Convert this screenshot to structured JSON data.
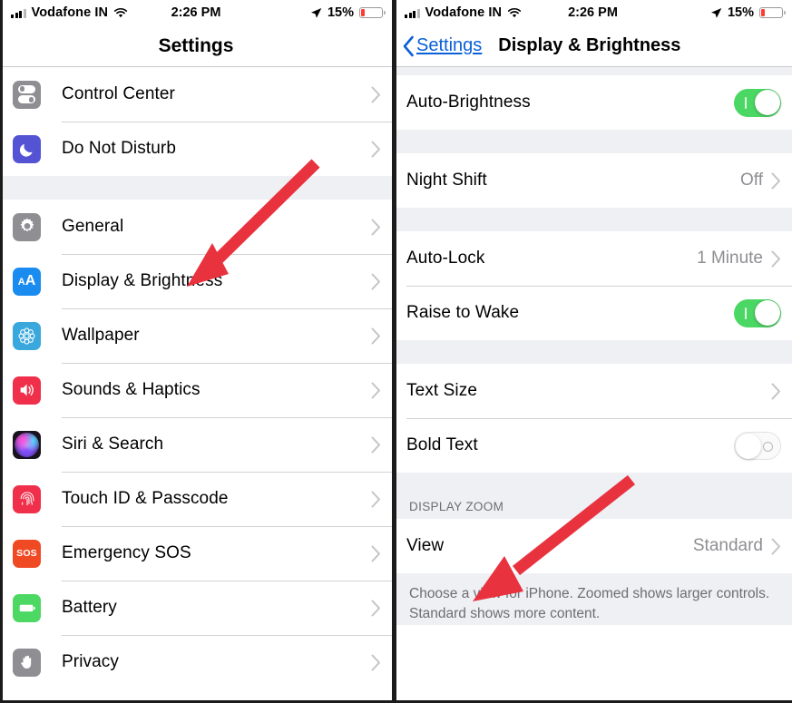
{
  "status_bar": {
    "carrier": "Vodafone IN",
    "time": "2:26 PM",
    "battery_percent": "15%",
    "signal_icon": "cellular-signal-icon",
    "wifi_icon": "wifi-icon",
    "location_icon": "location-arrow-icon",
    "battery_icon": "battery-icon"
  },
  "left_screen": {
    "nav": {
      "title": "Settings"
    },
    "groups": [
      {
        "items": [
          {
            "label": "Control Center",
            "icon": "control-center-icon"
          },
          {
            "label": "Do Not Disturb",
            "icon": "moon-icon"
          }
        ]
      },
      {
        "items": [
          {
            "label": "General",
            "icon": "gear-icon"
          },
          {
            "label": "Display & Brightness",
            "icon": "display-brightness-icon"
          },
          {
            "label": "Wallpaper",
            "icon": "wallpaper-flower-icon"
          },
          {
            "label": "Sounds & Haptics",
            "icon": "speaker-icon"
          },
          {
            "label": "Siri & Search",
            "icon": "siri-orb-icon"
          },
          {
            "label": "Touch ID & Passcode",
            "icon": "fingerprint-icon"
          },
          {
            "label": "Emergency SOS",
            "icon": "sos-icon"
          },
          {
            "label": "Battery",
            "icon": "battery-settings-icon"
          },
          {
            "label": "Privacy",
            "icon": "hand-icon"
          }
        ]
      }
    ]
  },
  "right_screen": {
    "nav": {
      "back_label": "Settings",
      "title": "Display & Brightness"
    },
    "rows": {
      "auto_brightness": {
        "label": "Auto-Brightness",
        "toggle": "on"
      },
      "night_shift": {
        "label": "Night Shift",
        "value": "Off"
      },
      "auto_lock": {
        "label": "Auto-Lock",
        "value": "1 Minute"
      },
      "raise_to_wake": {
        "label": "Raise to Wake",
        "toggle": "on"
      },
      "text_size": {
        "label": "Text Size",
        "value": ""
      },
      "bold_text": {
        "label": "Bold Text",
        "toggle": "off"
      },
      "view": {
        "label": "View",
        "value": "Standard"
      }
    },
    "display_zoom": {
      "header": "DISPLAY ZOOM",
      "footer": "Choose a view for iPhone. Zoomed shows larger controls. Standard shows more content."
    }
  },
  "annotations": {
    "arrow_color": "#e8333f",
    "arrow_left_target": "Display & Brightness",
    "arrow_right_target": "View"
  }
}
